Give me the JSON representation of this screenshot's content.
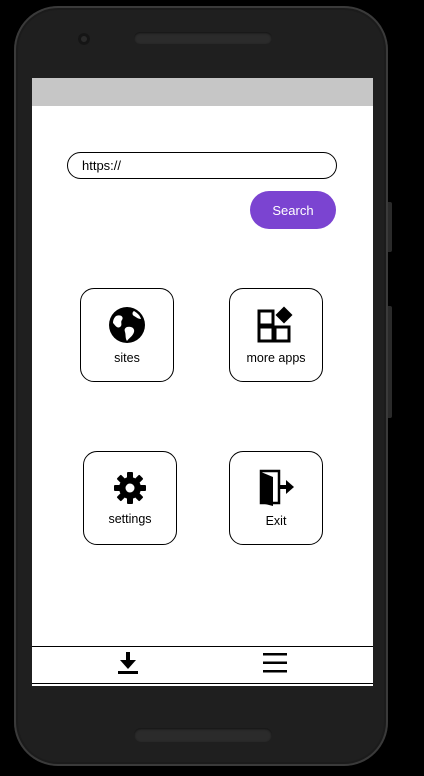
{
  "search": {
    "url_value": "https://",
    "button_label": "Search"
  },
  "tiles": {
    "sites": {
      "label": "sites",
      "icon": "globe-icon"
    },
    "more_apps": {
      "label": "more apps",
      "icon": "apps-icon"
    },
    "settings": {
      "label": "settings",
      "icon": "gear-icon"
    },
    "exit": {
      "label": "Exit",
      "icon": "exit-door-icon"
    }
  },
  "bottom_nav": {
    "download_icon": "download-icon",
    "menu_icon": "menu-icon"
  },
  "colors": {
    "accent": "#7b44d1",
    "status_bar": "#c6c6c6"
  }
}
